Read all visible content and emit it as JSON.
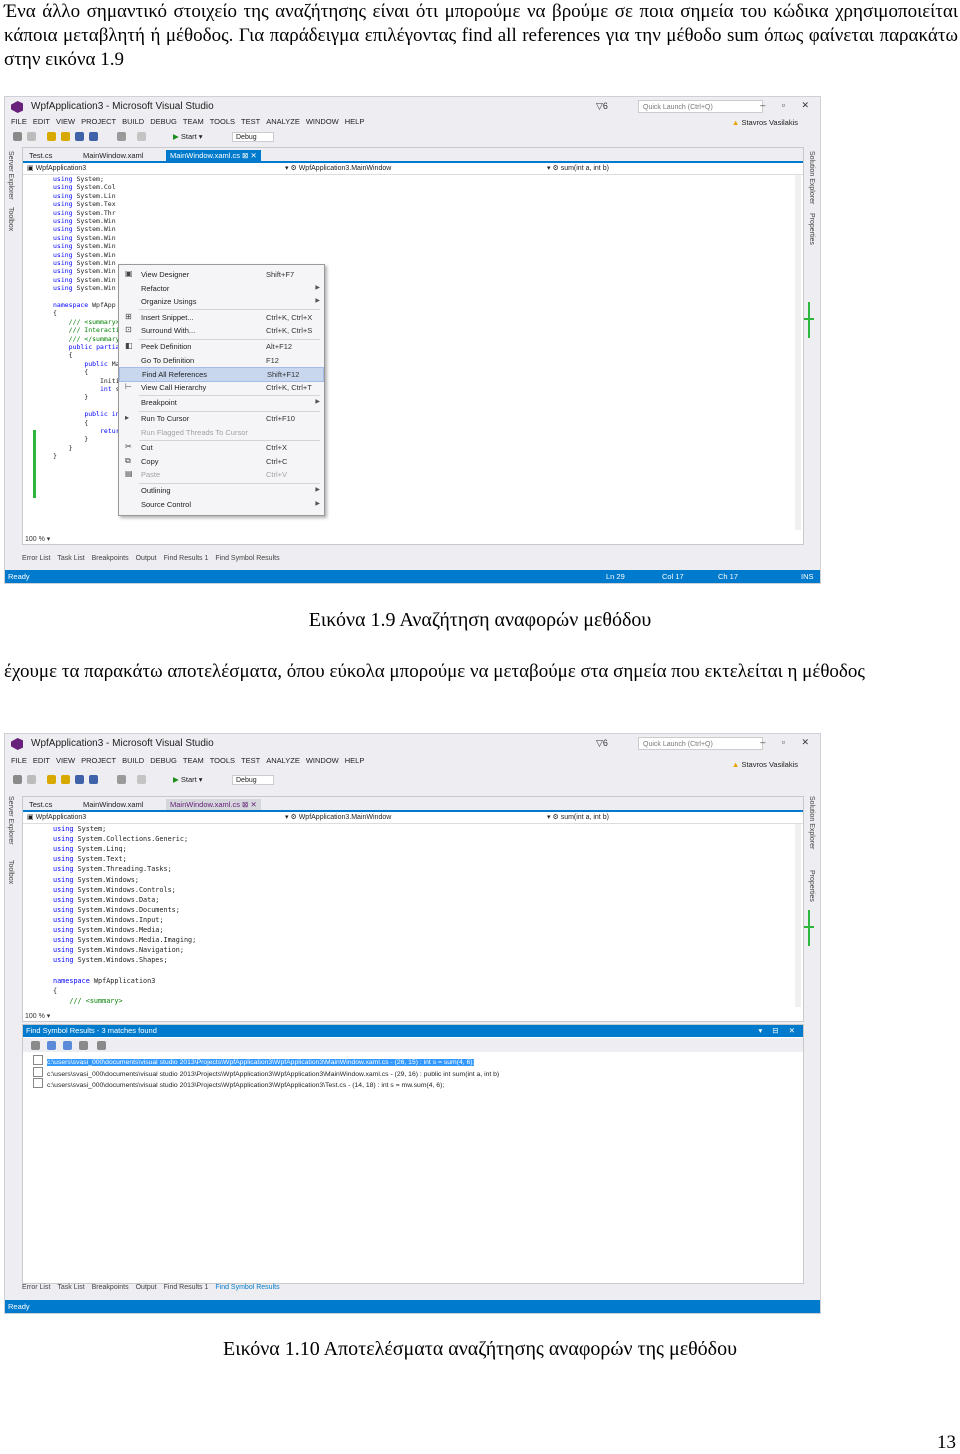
{
  "intro_paragraph": "Ένα άλλο σημαντικό στοιχείο της αναζήτησης είναι ότι μπορούμε να βρούμε σε ποια σημεία του κώδικα χρησιμοποιείται κάποια μεταβλητή ή μέθοδος. Για παράδειγμα επιλέγοντας find all references για την μέθοδο sum όπως φαίνεται παρακάτω στην εικόνα 1.9",
  "caption1": "Εικόνα 1.9 Αναζήτηση αναφορών μεθόδου",
  "middle_paragraph": "έχουμε τα παρακάτω αποτελέσματα, όπου εύκολα μπορούμε να μεταβούμε στα σημεία που εκτελείται η μέθοδος",
  "caption2": "Εικόνα 1.10 Αποτελέσματα αναζήτησης αναφορών της μεθόδου",
  "page_number": "13",
  "colors": {
    "accent": "#007acc",
    "vs_purple": "#68217a",
    "change_marker": "#2db83d",
    "highlight": "#3399ff"
  },
  "vs_common": {
    "window_title": "WpfApplication3 - Microsoft Visual Studio",
    "notifications": "▽6",
    "quick_launch": "Quick Launch (Ctrl+Q)",
    "window_buttons": "– ▫ ✕",
    "menu": [
      "FILE",
      "EDIT",
      "VIEW",
      "PROJECT",
      "BUILD",
      "DEBUG",
      "TEAM",
      "TOOLS",
      "TEST",
      "ANALYZE",
      "WINDOW",
      "HELP"
    ],
    "user": "Stavros Vasilakis",
    "start_button": "Start",
    "config": "Debug",
    "left_tabs": [
      "Server Explorer",
      "Toolbox"
    ],
    "right_tabs": [
      "Solution Explorer",
      "Properties"
    ],
    "tabs": [
      "Test.cs",
      "MainWindow.xaml",
      "MainWindow.xaml.cs"
    ],
    "nav_project": "WpfApplication3",
    "nav_class": "WpfApplication3.MainWindow",
    "nav_member": "sum(int a, int b)",
    "zoom": "100 %",
    "bottom_tabs": [
      "Error List",
      "Task List",
      "Breakpoints",
      "Output",
      "Find Results 1",
      "Find Symbol Results"
    ],
    "status_ready": "Ready"
  },
  "shot1": {
    "status": {
      "ln": "Ln 29",
      "col": "Col 17",
      "ch": "Ch 17",
      "mode": "INS"
    },
    "code_lines": [
      "using System;",
      "using System.Col",
      "using System.Lin",
      "using System.Tex",
      "using System.Thr",
      "using System.Win",
      "using System.Win",
      "using System.Win",
      "using System.Win",
      "using System.Win",
      "using System.Win",
      "using System.Win",
      "using System.Win",
      "using System.Win",
      "",
      "namespace WpfApp",
      "{",
      "    /// <summary>",
      "    /// Interactio",
      "    /// </summary>",
      "    public partial",
      "    {",
      "        public MainW",
      "        {",
      "            Initialize",
      "            int s = su",
      "        }",
      "",
      "        public int sum(int a, int b)",
      "        {",
      "            return a + b;",
      "        }",
      "    }",
      "}"
    ],
    "context_menu": [
      {
        "label": "View Designer",
        "shortcut": "Shift+F7",
        "icon": "▣"
      },
      {
        "label": "Refactor",
        "shortcut": "",
        "arrow": "▶"
      },
      {
        "label": "Organize Usings",
        "shortcut": "",
        "arrow": "▶"
      },
      {
        "label": "Insert Snippet...",
        "shortcut": "Ctrl+K, Ctrl+X",
        "icon": "⊞"
      },
      {
        "label": "Surround With...",
        "shortcut": "Ctrl+K, Ctrl+S",
        "icon": "⊡"
      },
      {
        "label": "Peek Definition",
        "shortcut": "Alt+F12",
        "icon": "◧"
      },
      {
        "label": "Go To Definition",
        "shortcut": "F12"
      },
      {
        "label": "Find All References",
        "shortcut": "Shift+F12",
        "highlighted": true
      },
      {
        "label": "View Call Hierarchy",
        "shortcut": "Ctrl+K, Ctrl+T",
        "icon": "⊢"
      },
      {
        "label": "Breakpoint",
        "shortcut": "",
        "arrow": "▶"
      },
      {
        "label": "Run To Cursor",
        "shortcut": "Ctrl+F10",
        "icon": "▸"
      },
      {
        "label": "Run Flagged Threads To Cursor",
        "shortcut": "",
        "disabled": true
      },
      {
        "label": "Cut",
        "shortcut": "Ctrl+X",
        "icon": "✂"
      },
      {
        "label": "Copy",
        "shortcut": "Ctrl+C",
        "icon": "⧉"
      },
      {
        "label": "Paste",
        "shortcut": "Ctrl+V",
        "disabled": true,
        "icon": "▤"
      },
      {
        "label": "Outlining",
        "shortcut": "",
        "arrow": "▶"
      },
      {
        "label": "Source Control",
        "shortcut": "",
        "arrow": "▶"
      }
    ]
  },
  "shot2": {
    "code_lines": [
      "using System;",
      "using System.Collections.Generic;",
      "using System.Linq;",
      "using System.Text;",
      "using System.Threading.Tasks;",
      "using System.Windows;",
      "using System.Windows.Controls;",
      "using System.Windows.Data;",
      "using System.Windows.Documents;",
      "using System.Windows.Input;",
      "using System.Windows.Media;",
      "using System.Windows.Media.Imaging;",
      "using System.Windows.Navigation;",
      "using System.Windows.Shapes;",
      "",
      "namespace WpfApplication3",
      "{",
      "    /// <summary>"
    ],
    "find_panel_title": "Find Symbol Results - 3 matches found",
    "find_panel_controls": "▾ ⊟ ✕",
    "results": [
      "c:\\users\\svasi_000\\documents\\visual studio 2013\\Projects\\WpfApplication3\\WpfApplication3\\MainWindow.xaml.cs - (26, 15) : int s = sum(4, 6);",
      "c:\\users\\svasi_000\\documents\\visual studio 2013\\Projects\\WpfApplication3\\WpfApplication3\\MainWindow.xaml.cs - (29, 16) : public int sum(int a, int b)",
      "c:\\users\\svasi_000\\documents\\visual studio 2013\\Projects\\WpfApplication3\\WpfApplication3\\Test.cs - (14, 18) : int s = mw.sum(4, 6);"
    ]
  }
}
